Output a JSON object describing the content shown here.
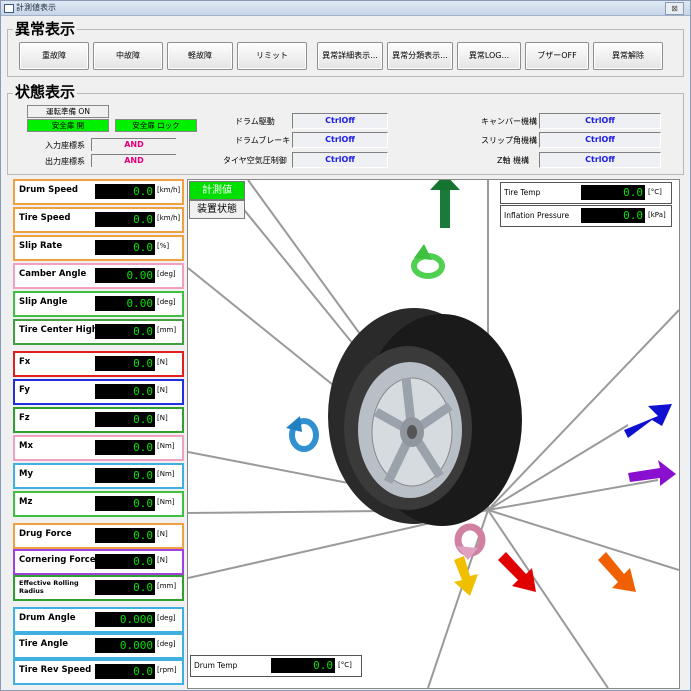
{
  "window": {
    "title": "計測値表示",
    "close_label": "⊠"
  },
  "alarm": {
    "title": "異常表示",
    "buttons": [
      {
        "label": "重故障"
      },
      {
        "label": "中故障"
      },
      {
        "label": "軽故障"
      },
      {
        "label": "リミット"
      },
      {
        "label": "異常詳細表示..."
      },
      {
        "label": "異常分類表示..."
      },
      {
        "label": "異常LOG..."
      },
      {
        "label": "ブザーOFF"
      },
      {
        "label": "異常解除"
      }
    ]
  },
  "status": {
    "title": "状態表示",
    "ready": "運転準備 ON",
    "door_open": "安全扉 開",
    "door_lock": "安全扉 ロック",
    "input_coord_label": "入力座標系",
    "input_coord_value": "AND",
    "output_coord_label": "出力座標系",
    "output_coord_value": "AND",
    "mid_rows": [
      {
        "label": "ドラム駆動",
        "value": "CtrlOff"
      },
      {
        "label": "ドラムブレーキ",
        "value": "CtrlOff"
      },
      {
        "label": "タイヤ空気圧制御",
        "value": "CtrlOff"
      }
    ],
    "right_rows": [
      {
        "label": "キャンバー機構",
        "value": "CtrlOff"
      },
      {
        "label": "スリップ角機構",
        "value": "CtrlOff"
      },
      {
        "label": "Z軸 機構",
        "value": "CtrlOff"
      }
    ]
  },
  "monitors": [
    {
      "name": "Drum Speed",
      "value": "0.0",
      "unit": "[km/h]",
      "color": "#f0a040"
    },
    {
      "name": "Tire Speed",
      "value": "0.0",
      "unit": "[km/h]",
      "color": "#f0a040"
    },
    {
      "name": "Slip Rate",
      "value": "0.0",
      "unit": "[%]",
      "color": "#f0a040"
    },
    {
      "name": "Camber Angle",
      "value": "0.00",
      "unit": "[deg]",
      "color": "#f0a0c0"
    },
    {
      "name": "Slip Angle",
      "value": "0.00",
      "unit": "[deg]",
      "color": "#40c040"
    },
    {
      "name": "Tire Center Hight",
      "value": "0.0",
      "unit": "[mm]",
      "color": "#40a040"
    },
    {
      "name": "Fx",
      "value": "0.0",
      "unit": "[N]",
      "color": "#e02020"
    },
    {
      "name": "Fy",
      "value": "0.0",
      "unit": "[N]",
      "color": "#2030e0"
    },
    {
      "name": "Fz",
      "value": "0.0",
      "unit": "[N]",
      "color": "#30a030"
    },
    {
      "name": "Mx",
      "value": "0.0",
      "unit": "[Nm]",
      "color": "#f0a0c0"
    },
    {
      "name": "My",
      "value": "0.0",
      "unit": "[Nm]",
      "color": "#40b0e0"
    },
    {
      "name": "Mz",
      "value": "0.0",
      "unit": "[Nm]",
      "color": "#40c040"
    },
    {
      "name": "Drug Force",
      "value": "0.0",
      "unit": "[N]",
      "color": "#f0a040"
    },
    {
      "name": "Cornering Force",
      "value": "0.0",
      "unit": "[N]",
      "color": "#a040e0"
    },
    {
      "name": "Effective Rolling Radius",
      "value": "0.0",
      "unit": "[mm]",
      "color": "#30a030"
    },
    {
      "name": "Drum Angle",
      "value": "0.000",
      "unit": "[deg]",
      "color": "#40b0e0"
    },
    {
      "name": "Tire Angle",
      "value": "0.000",
      "unit": "[deg]",
      "color": "#40b0e0"
    },
    {
      "name": "Tire Rev Speed",
      "value": "0.0",
      "unit": "[rpm]",
      "color": "#40b0e0"
    }
  ],
  "view": {
    "tab_measure": "計測値",
    "tab_device": "装置状態",
    "tire_temp": {
      "name": "Tire Temp",
      "value": "0.0",
      "unit": "[°C]"
    },
    "inflation": {
      "name": "Inflation Pressure",
      "value": "0.0",
      "unit": "[kPa]"
    },
    "drum_temp": {
      "name": "Drum Temp",
      "value": "0.0",
      "unit": "[°C]"
    }
  }
}
